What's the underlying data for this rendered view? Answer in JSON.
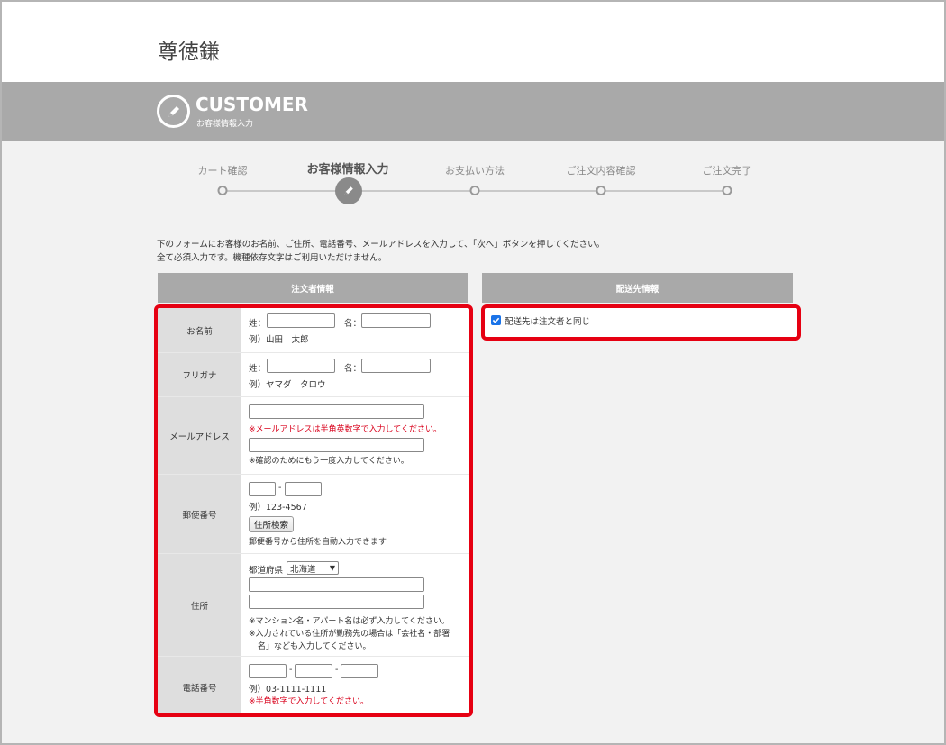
{
  "header": {
    "shop_name": "尊徳鎌"
  },
  "banner": {
    "title": "CUSTOMER",
    "subtitle": "お客様情報入力"
  },
  "steps": [
    {
      "label": "カート確認",
      "active": false
    },
    {
      "label": "お客様情報入力",
      "active": true
    },
    {
      "label": "お支払い方法",
      "active": false
    },
    {
      "label": "ご注文内容確認",
      "active": false
    },
    {
      "label": "ご注文完了",
      "active": false
    }
  ],
  "intro": {
    "line1": "下のフォームにお客様のお名前、ご住所、電話番号、メールアドレスを入力して、「次へ」ボタンを押してください。",
    "line2": "全て必須入力です。機種依存文字はご利用いただけません。"
  },
  "orderer_panel": {
    "title": "注文者情報"
  },
  "shipping_panel": {
    "title": "配送先情報",
    "same_as_orderer_label": "配送先は注文者と同じ",
    "same_as_orderer_checked": true
  },
  "form": {
    "name": {
      "label": "お名前",
      "sei_label": "姓：",
      "mei_label": "名：",
      "sei_value": "",
      "mei_value": "",
      "example": "例）山田　太郎"
    },
    "furigana": {
      "label": "フリガナ",
      "sei_label": "姓：",
      "mei_label": "名：",
      "sei_value": "",
      "mei_value": "",
      "example": "例）ヤマダ　タロウ"
    },
    "email": {
      "label": "メールアドレス",
      "value": "",
      "note": "※メールアドレスは半角英数字で入力してください。",
      "confirm_value": "",
      "confirm_note": "※確認のためにもう一度入力してください。"
    },
    "postal": {
      "label": "郵便番号",
      "part1": "",
      "part2": "",
      "dash": "-",
      "example": "例）123-4567",
      "search_button": "住所検索",
      "note": "郵便番号から住所を自動入力できます"
    },
    "address": {
      "label": "住所",
      "pref_label": "都道府県",
      "pref_value": "北海道",
      "line1": "",
      "line2": "",
      "note1": "※マンション名・アパート名は必ず入力してください。",
      "note2": "※入力されている住所が勤務先の場合は「会社名・部署",
      "note3": "名」なども入力してください。"
    },
    "phone": {
      "label": "電話番号",
      "part1": "",
      "part2": "",
      "part3": "",
      "dash": "-",
      "example": "例）03-1111-1111",
      "note": "※半角数字で入力してください。"
    }
  },
  "colors": {
    "highlight": "#e60012",
    "banner": "#a9a9a9",
    "checkbox": "#1a73e8"
  }
}
